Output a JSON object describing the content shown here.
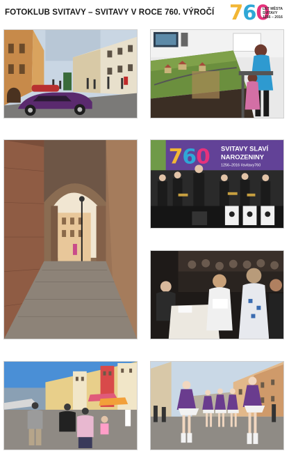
{
  "header": {
    "title": "FOTOKLUB SVITAVY – SVITAVY V ROCE 760. VÝROČÍ",
    "logo": {
      "digits": [
        "7",
        "6",
        "0"
      ],
      "line1": "LET MĚSTA",
      "line2": "SVITAVY",
      "line3": "1256 – 2016",
      "colors": [
        "#f2b634",
        "#2fa7d6",
        "#e7317c"
      ]
    }
  },
  "photos": [
    {
      "name": "photo-town-square-vintage-car"
    },
    {
      "name": "photo-model-railway-exhibition"
    },
    {
      "name": "photo-stone-archway-street"
    },
    {
      "name": "photo-birthday-concert-band",
      "banner": {
        "number": "760",
        "line1": "SVITAVY SLAVÍ",
        "line2": "NAROZENINY",
        "line3": "1256–2016  #svitavy760"
      }
    },
    {
      "name": "photo-audience-table-event"
    },
    {
      "name": "photo-market-square-crowd"
    },
    {
      "name": "photo-majorettes-parade"
    }
  ]
}
